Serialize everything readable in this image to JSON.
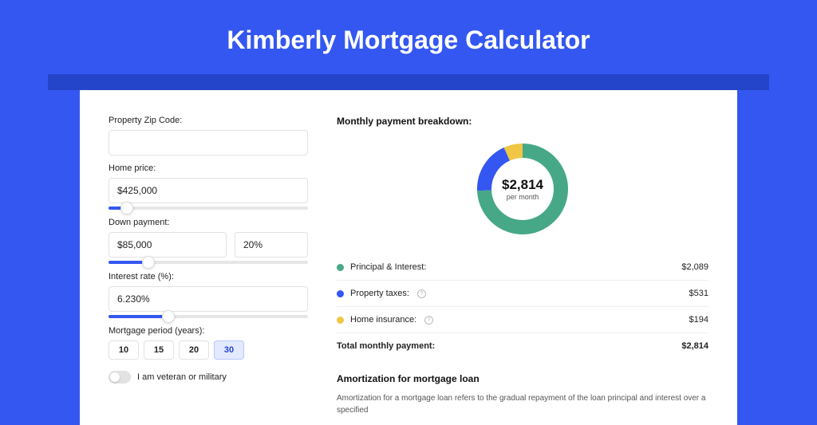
{
  "title": "Kimberly Mortgage Calculator",
  "colors": {
    "principal": "#46a887",
    "taxes": "#3457f1",
    "insurance": "#f1c644"
  },
  "form": {
    "zip": {
      "label": "Property Zip Code:",
      "value": ""
    },
    "price": {
      "label": "Home price:",
      "value": "$425,000",
      "slider_pct": 9
    },
    "down": {
      "label": "Down payment:",
      "amount": "$85,000",
      "pct": "20%",
      "slider_pct": 20
    },
    "rate": {
      "label": "Interest rate (%):",
      "value": "6.230%",
      "slider_pct": 30
    },
    "period": {
      "label": "Mortgage period (years):",
      "options": [
        "10",
        "15",
        "20",
        "30"
      ],
      "selected": "30"
    },
    "veteran_label": "I am veteran or military",
    "veteran_on": false
  },
  "breakdown": {
    "title": "Monthly payment breakdown:",
    "center_amount": "$2,814",
    "center_sub": "per month",
    "items": [
      {
        "key": "principal",
        "label": "Principal & Interest:",
        "amount": "$2,089",
        "info": false
      },
      {
        "key": "taxes",
        "label": "Property taxes:",
        "amount": "$531",
        "info": true
      },
      {
        "key": "insurance",
        "label": "Home insurance:",
        "amount": "$194",
        "info": true
      }
    ],
    "total_label": "Total monthly payment:",
    "total_amount": "$2,814"
  },
  "chart_data": {
    "type": "pie",
    "title": "Monthly payment breakdown",
    "series": [
      {
        "name": "Principal & Interest",
        "value": 2089,
        "color": "#46a887"
      },
      {
        "name": "Property taxes",
        "value": 531,
        "color": "#3457f1"
      },
      {
        "name": "Home insurance",
        "value": 194,
        "color": "#f1c644"
      }
    ],
    "total": 2814,
    "center_label": "$2,814 per month"
  },
  "amort": {
    "title": "Amortization for mortgage loan",
    "text": "Amortization for a mortgage loan refers to the gradual repayment of the loan principal and interest over a specified"
  }
}
